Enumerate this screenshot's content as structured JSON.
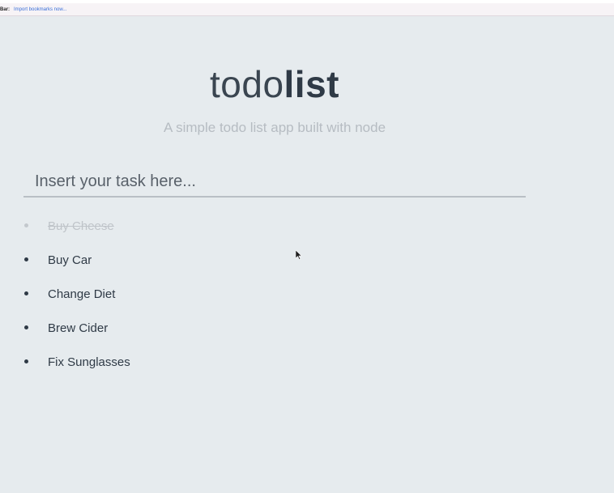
{
  "bookmarks_bar": {
    "label": "Bar:",
    "link": "Import bookmarks now..."
  },
  "app": {
    "title_light": "todo",
    "title_bold": "list",
    "subtitle": "A simple todo list app built with node"
  },
  "task_input": {
    "placeholder": "Insert your task here...",
    "value": ""
  },
  "tasks": [
    {
      "label": "Buy Cheese",
      "completed": true
    },
    {
      "label": "Buy Car",
      "completed": false
    },
    {
      "label": "Change Diet",
      "completed": false
    },
    {
      "label": "Brew Cider",
      "completed": false
    },
    {
      "label": "Fix Sunglasses",
      "completed": false
    }
  ],
  "colors": {
    "background": "#e6ebee",
    "text_dark": "#2f3a46",
    "text_muted": "#b6bcc2",
    "completed_text": "#bfc4c9"
  }
}
